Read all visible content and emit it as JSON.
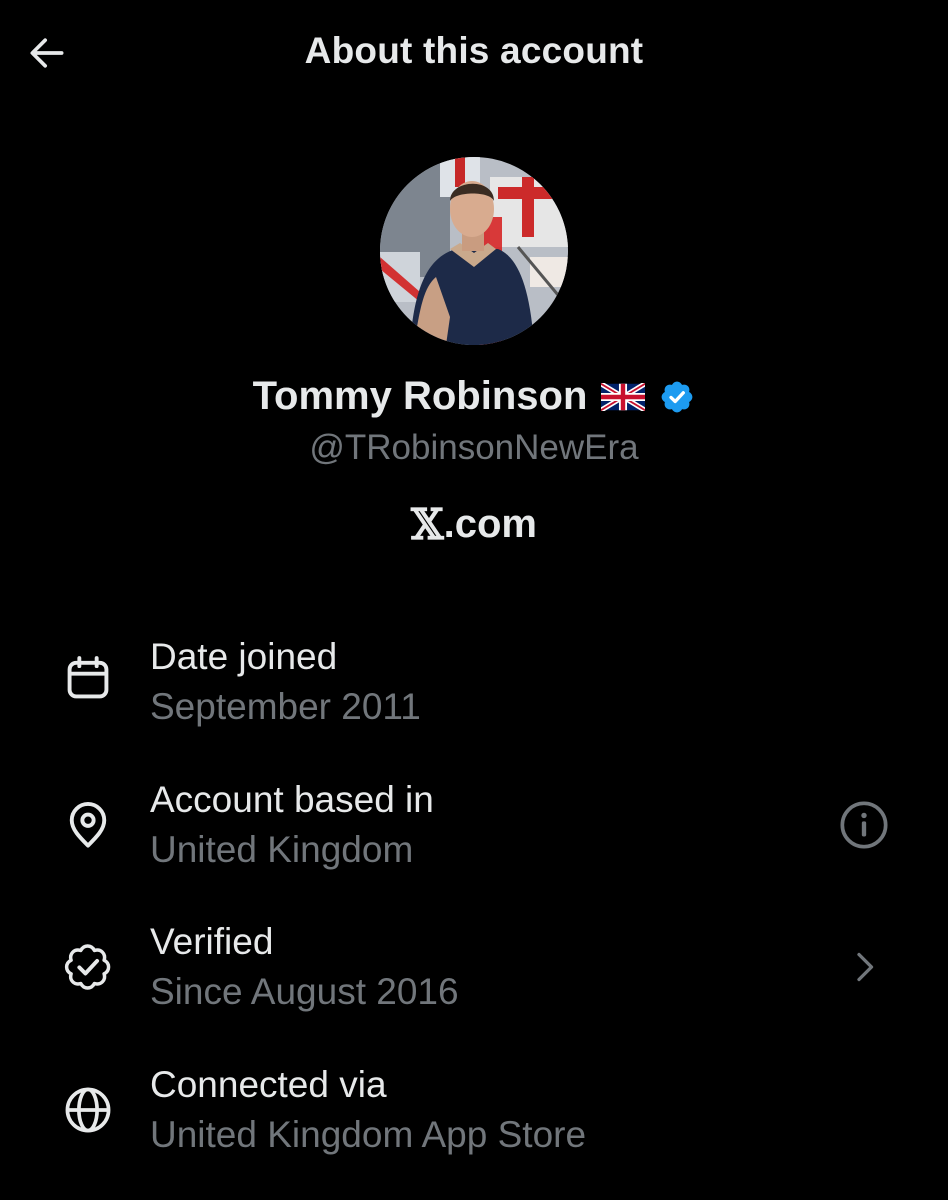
{
  "header": {
    "title": "About this account",
    "back_icon": "arrow-left-icon"
  },
  "profile": {
    "display_name": "Tommy Robinson",
    "flag_emoji": "🇬🇧",
    "verified_icon": "verified-badge-icon",
    "handle": "@TRobinsonNewEra",
    "site_mark": "𝕏",
    "site_domain": ".com"
  },
  "details": [
    {
      "icon": "calendar-icon",
      "label": "Date joined",
      "value": "September 2011"
    },
    {
      "icon": "location-pin-icon",
      "label": "Account based in",
      "value": "United Kingdom",
      "action_icon": "info-icon"
    },
    {
      "icon": "verified-check-icon",
      "label": "Verified",
      "value": "Since August 2016",
      "action_icon": "chevron-right-icon"
    },
    {
      "icon": "globe-icon",
      "label": "Connected via",
      "value": "United Kingdom App Store"
    }
  ],
  "colors": {
    "background": "#000000",
    "primary_text": "#e7e9ea",
    "secondary_text": "#71767b",
    "verified_blue": "#1d9bf0"
  }
}
